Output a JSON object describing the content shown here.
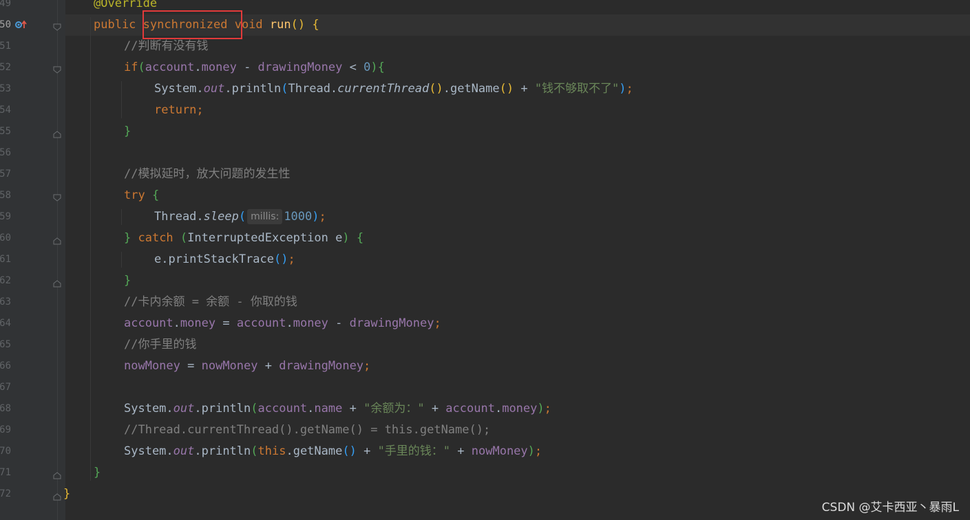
{
  "lines": [
    {
      "n": "49",
      "ind": 0,
      "tokens": [
        {
          "c": "ann",
          "t": "@Override"
        }
      ]
    },
    {
      "n": "50",
      "ind": 0,
      "current": true,
      "tokens": [
        {
          "c": "kw",
          "t": "public "
        },
        {
          "c": "kw",
          "t": "synchronized"
        },
        {
          "c": "kw",
          "t": " void "
        },
        {
          "c": "fn",
          "t": "run"
        },
        {
          "c": "br1",
          "t": "()"
        },
        {
          "t": " "
        },
        {
          "c": "br1",
          "t": "{"
        }
      ]
    },
    {
      "n": "51",
      "ind": 1,
      "tokens": [
        {
          "c": "cmt",
          "t": "//判断有没有钱"
        }
      ]
    },
    {
      "n": "52",
      "ind": 1,
      "tokens": [
        {
          "c": "kw",
          "t": "if"
        },
        {
          "c": "br2",
          "t": "("
        },
        {
          "c": "fld",
          "t": "account"
        },
        {
          "t": "."
        },
        {
          "c": "fld",
          "t": "money"
        },
        {
          "t": " - "
        },
        {
          "c": "fld",
          "t": "drawingMoney"
        },
        {
          "t": " < "
        },
        {
          "c": "num",
          "t": "0"
        },
        {
          "c": "br2",
          "t": ")"
        },
        {
          "c": "br2",
          "t": "{"
        }
      ]
    },
    {
      "n": "53",
      "ind": 2,
      "tokens": [
        {
          "t": "System."
        },
        {
          "c": "fld it",
          "t": "out"
        },
        {
          "t": ".println"
        },
        {
          "c": "br3",
          "t": "("
        },
        {
          "t": "Thread."
        },
        {
          "c": "it",
          "t": "currentThread"
        },
        {
          "c": "br1",
          "t": "()"
        },
        {
          "t": ".getName"
        },
        {
          "c": "br1",
          "t": "()"
        },
        {
          "t": " + "
        },
        {
          "c": "str",
          "t": "\"钱不够取不了\""
        },
        {
          "c": "br3",
          "t": ")"
        },
        {
          "c": "kw",
          "t": ";"
        }
      ]
    },
    {
      "n": "54",
      "ind": 2,
      "tokens": [
        {
          "c": "kw",
          "t": "return;"
        }
      ]
    },
    {
      "n": "55",
      "ind": 1,
      "tokens": [
        {
          "c": "br2",
          "t": "}"
        }
      ]
    },
    {
      "n": "56",
      "ind": 0,
      "tokens": []
    },
    {
      "n": "57",
      "ind": 1,
      "tokens": [
        {
          "c": "cmt",
          "t": "//模拟延时，放大问题的发生性"
        }
      ]
    },
    {
      "n": "58",
      "ind": 1,
      "tokens": [
        {
          "c": "kw",
          "t": "try "
        },
        {
          "c": "br2",
          "t": "{"
        }
      ]
    },
    {
      "n": "59",
      "ind": 2,
      "tokens": [
        {
          "t": "Thread."
        },
        {
          "c": "it",
          "t": "sleep"
        },
        {
          "c": "br3",
          "t": "("
        },
        {
          "hint": "millis:"
        },
        {
          "c": "num",
          "t": "1000"
        },
        {
          "c": "br3",
          "t": ")"
        },
        {
          "c": "kw",
          "t": ";"
        }
      ]
    },
    {
      "n": "60",
      "ind": 1,
      "tokens": [
        {
          "c": "br2",
          "t": "}"
        },
        {
          "c": "kw",
          "t": " catch "
        },
        {
          "c": "br2",
          "t": "("
        },
        {
          "t": "InterruptedException e"
        },
        {
          "c": "br2",
          "t": ")"
        },
        {
          "t": " "
        },
        {
          "c": "br2",
          "t": "{"
        }
      ]
    },
    {
      "n": "61",
      "ind": 2,
      "tokens": [
        {
          "t": "e.printStackTrace"
        },
        {
          "c": "br3",
          "t": "()"
        },
        {
          "c": "kw",
          "t": ";"
        }
      ]
    },
    {
      "n": "62",
      "ind": 1,
      "tokens": [
        {
          "c": "br2",
          "t": "}"
        }
      ]
    },
    {
      "n": "63",
      "ind": 1,
      "tokens": [
        {
          "c": "cmt",
          "t": "//卡内余额 = 余额 - 你取的钱"
        }
      ]
    },
    {
      "n": "64",
      "ind": 1,
      "tokens": [
        {
          "c": "fld",
          "t": "account"
        },
        {
          "t": "."
        },
        {
          "c": "fld",
          "t": "money"
        },
        {
          "t": " = "
        },
        {
          "c": "fld",
          "t": "account"
        },
        {
          "t": "."
        },
        {
          "c": "fld",
          "t": "money"
        },
        {
          "t": " - "
        },
        {
          "c": "fld",
          "t": "drawingMoney"
        },
        {
          "c": "kw",
          "t": ";"
        }
      ]
    },
    {
      "n": "65",
      "ind": 1,
      "tokens": [
        {
          "c": "cmt",
          "t": "//你手里的钱"
        }
      ]
    },
    {
      "n": "66",
      "ind": 1,
      "tokens": [
        {
          "c": "fld",
          "t": "nowMoney"
        },
        {
          "t": " = "
        },
        {
          "c": "fld",
          "t": "nowMoney"
        },
        {
          "t": " + "
        },
        {
          "c": "fld",
          "t": "drawingMoney"
        },
        {
          "c": "kw",
          "t": ";"
        }
      ]
    },
    {
      "n": "67",
      "ind": 0,
      "tokens": []
    },
    {
      "n": "68",
      "ind": 1,
      "tokens": [
        {
          "t": "System."
        },
        {
          "c": "fld it",
          "t": "out"
        },
        {
          "t": ".println"
        },
        {
          "c": "br2",
          "t": "("
        },
        {
          "c": "fld",
          "t": "account"
        },
        {
          "t": "."
        },
        {
          "c": "fld",
          "t": "name"
        },
        {
          "t": " + "
        },
        {
          "c": "str",
          "t": "\"余额为：\""
        },
        {
          "t": " + "
        },
        {
          "c": "fld",
          "t": "account"
        },
        {
          "t": "."
        },
        {
          "c": "fld",
          "t": "money"
        },
        {
          "c": "br2",
          "t": ")"
        },
        {
          "c": "kw",
          "t": ";"
        }
      ]
    },
    {
      "n": "69",
      "ind": 1,
      "tokens": [
        {
          "c": "cmt",
          "t": "//Thread.currentThread().getName() = this.getName();"
        }
      ]
    },
    {
      "n": "70",
      "ind": 1,
      "tokens": [
        {
          "t": "System."
        },
        {
          "c": "fld it",
          "t": "out"
        },
        {
          "t": ".println"
        },
        {
          "c": "br2",
          "t": "("
        },
        {
          "c": "kw",
          "t": "this"
        },
        {
          "t": ".getName"
        },
        {
          "c": "br3",
          "t": "()"
        },
        {
          "t": " + "
        },
        {
          "c": "str",
          "t": "\"手里的钱：\""
        },
        {
          "t": " + "
        },
        {
          "c": "fld",
          "t": "nowMoney"
        },
        {
          "c": "br2",
          "t": ")"
        },
        {
          "c": "kw",
          "t": ";"
        }
      ]
    },
    {
      "n": "71",
      "ind": 0,
      "tokens": [
        {
          "c": "br2",
          "t": "}"
        }
      ]
    },
    {
      "n": "72",
      "ind": -1,
      "tokens": [
        {
          "c": "br1",
          "t": "}"
        }
      ]
    }
  ],
  "gutter": {
    "override_icon": "override-marker-icon"
  },
  "watermark": "CSDN @艾卡西亚丶暴雨L"
}
